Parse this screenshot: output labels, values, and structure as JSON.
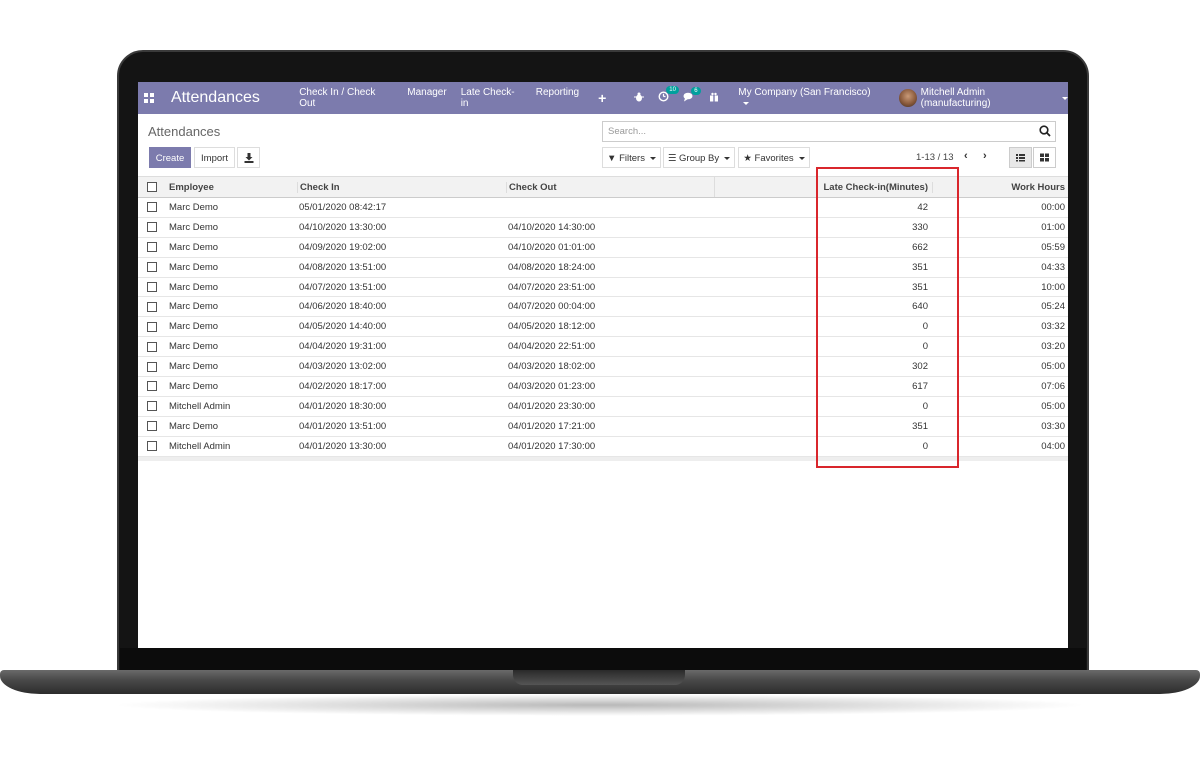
{
  "navbar": {
    "app_title": "Attendances",
    "menu": [
      "Check In / Check Out",
      "Manager",
      "Late Check-in",
      "Reporting"
    ],
    "plus": "+",
    "activity_badge": "10",
    "messages_badge": "6",
    "company": "My Company (San Francisco)",
    "user": "Mitchell Admin (manufacturing)"
  },
  "control_panel": {
    "title": "Attendances",
    "create_label": "Create",
    "import_label": "Import",
    "search_placeholder": "Search...",
    "filters_label": "Filters",
    "groupby_label": "Group By",
    "favorites_label": "Favorites",
    "pager": "1-13 / 13"
  },
  "table": {
    "headers": {
      "employee": "Employee",
      "check_in": "Check In",
      "check_out": "Check Out",
      "late": "Late Check-in(Minutes)",
      "work_hours": "Work Hours"
    },
    "rows": [
      {
        "employee": "Marc Demo",
        "check_in": "05/01/2020 08:42:17",
        "check_out": "",
        "late": "42",
        "work_hours": "00:00"
      },
      {
        "employee": "Marc Demo",
        "check_in": "04/10/2020 13:30:00",
        "check_out": "04/10/2020 14:30:00",
        "late": "330",
        "work_hours": "01:00"
      },
      {
        "employee": "Marc Demo",
        "check_in": "04/09/2020 19:02:00",
        "check_out": "04/10/2020 01:01:00",
        "late": "662",
        "work_hours": "05:59"
      },
      {
        "employee": "Marc Demo",
        "check_in": "04/08/2020 13:51:00",
        "check_out": "04/08/2020 18:24:00",
        "late": "351",
        "work_hours": "04:33"
      },
      {
        "employee": "Marc Demo",
        "check_in": "04/07/2020 13:51:00",
        "check_out": "04/07/2020 23:51:00",
        "late": "351",
        "work_hours": "10:00"
      },
      {
        "employee": "Marc Demo",
        "check_in": "04/06/2020 18:40:00",
        "check_out": "04/07/2020 00:04:00",
        "late": "640",
        "work_hours": "05:24"
      },
      {
        "employee": "Marc Demo",
        "check_in": "04/05/2020 14:40:00",
        "check_out": "04/05/2020 18:12:00",
        "late": "0",
        "work_hours": "03:32"
      },
      {
        "employee": "Marc Demo",
        "check_in": "04/04/2020 19:31:00",
        "check_out": "04/04/2020 22:51:00",
        "late": "0",
        "work_hours": "03:20"
      },
      {
        "employee": "Marc Demo",
        "check_in": "04/03/2020 13:02:00",
        "check_out": "04/03/2020 18:02:00",
        "late": "302",
        "work_hours": "05:00"
      },
      {
        "employee": "Marc Demo",
        "check_in": "04/02/2020 18:17:00",
        "check_out": "04/03/2020 01:23:00",
        "late": "617",
        "work_hours": "07:06"
      },
      {
        "employee": "Mitchell Admin",
        "check_in": "04/01/2020 18:30:00",
        "check_out": "04/01/2020 23:30:00",
        "late": "0",
        "work_hours": "05:00"
      },
      {
        "employee": "Marc Demo",
        "check_in": "04/01/2020 13:51:00",
        "check_out": "04/01/2020 17:21:00",
        "late": "351",
        "work_hours": "03:30"
      },
      {
        "employee": "Mitchell Admin",
        "check_in": "04/01/2020 13:30:00",
        "check_out": "04/01/2020 17:30:00",
        "late": "0",
        "work_hours": "04:00"
      }
    ]
  },
  "colors": {
    "navbar": "#7c7bad",
    "highlight": "#d9262c",
    "badge": "#00a09d"
  }
}
